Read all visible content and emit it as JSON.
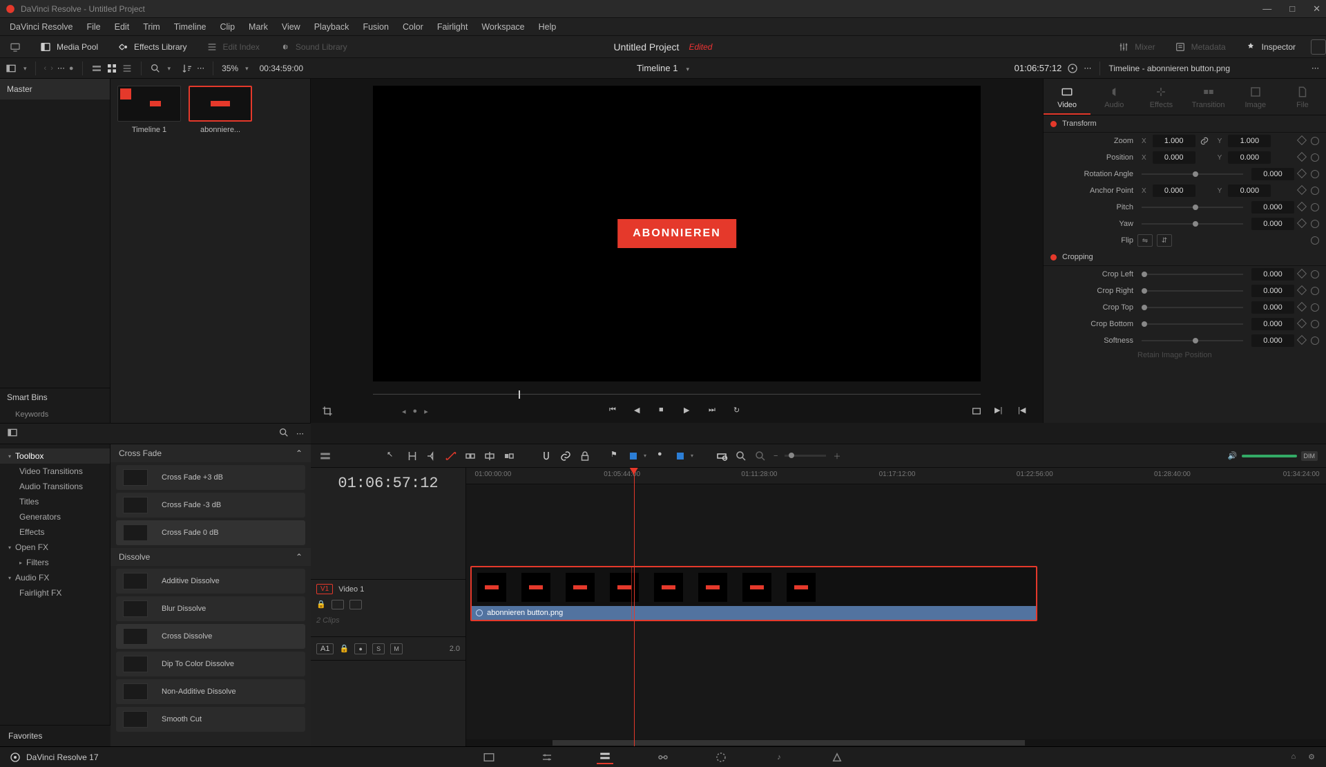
{
  "window": {
    "title": "DaVinci Resolve - Untitled Project"
  },
  "menu": [
    "DaVinci Resolve",
    "File",
    "Edit",
    "Trim",
    "Timeline",
    "Clip",
    "Mark",
    "View",
    "Playback",
    "Fusion",
    "Color",
    "Fairlight",
    "Workspace",
    "Help"
  ],
  "topPanels": {
    "mediaPool": "Media Pool",
    "effectsLib": "Effects Library",
    "editIndex": "Edit Index",
    "soundLib": "Sound Library",
    "mixer": "Mixer",
    "metadata": "Metadata",
    "inspector": "Inspector"
  },
  "project": {
    "name": "Untitled Project",
    "state": "Edited"
  },
  "subbar": {
    "zoom": "35%",
    "duration": "00:34:59:00",
    "timeline": "Timeline 1",
    "tc": "01:06:57:12"
  },
  "mediapool": {
    "root": "Master",
    "smartBins": "Smart Bins",
    "keywords": "Keywords"
  },
  "clips": [
    {
      "name": "Timeline 1",
      "selected": false,
      "timeline": true
    },
    {
      "name": "abonniere...",
      "selected": true,
      "timeline": false
    }
  ],
  "viewer": {
    "overlay": "ABONNIEREN"
  },
  "inspectorPanel": {
    "title": "Timeline - abonnieren button.png",
    "tabs": [
      "Video",
      "Audio",
      "Effects",
      "Transition",
      "Image",
      "File"
    ],
    "activeTab": 0,
    "transform": {
      "header": "Transform",
      "zoom": {
        "label": "Zoom",
        "x": "1.000",
        "y": "1.000"
      },
      "position": {
        "label": "Position",
        "x": "0.000",
        "y": "0.000"
      },
      "rotation": {
        "label": "Rotation Angle",
        "v": "0.000"
      },
      "anchor": {
        "label": "Anchor Point",
        "x": "0.000",
        "y": "0.000"
      },
      "pitch": {
        "label": "Pitch",
        "v": "0.000"
      },
      "yaw": {
        "label": "Yaw",
        "v": "0.000"
      },
      "flip": {
        "label": "Flip"
      }
    },
    "cropping": {
      "header": "Cropping",
      "left": {
        "label": "Crop Left",
        "v": "0.000"
      },
      "right": {
        "label": "Crop Right",
        "v": "0.000"
      },
      "top": {
        "label": "Crop Top",
        "v": "0.000"
      },
      "bottom": {
        "label": "Crop Bottom",
        "v": "0.000"
      },
      "soft": {
        "label": "Softness",
        "v": "0.000"
      },
      "retain": "Retain Image Position"
    }
  },
  "fxTree": {
    "toolbox": "Toolbox",
    "items": [
      "Video Transitions",
      "Audio Transitions",
      "Titles",
      "Generators",
      "Effects"
    ],
    "openfx": "Open FX",
    "filters": "Filters",
    "audiofx": "Audio FX",
    "fairlight": "Fairlight FX",
    "favorites": "Favorites"
  },
  "fxList": {
    "group1": "Cross Fade",
    "g1": [
      "Cross Fade +3 dB",
      "Cross Fade -3 dB",
      "Cross Fade 0 dB"
    ],
    "group2": "Dissolve",
    "g2": [
      "Additive Dissolve",
      "Blur Dissolve",
      "Cross Dissolve",
      "Dip To Color Dissolve",
      "Non-Additive Dissolve",
      "Smooth Cut"
    ]
  },
  "timeline": {
    "bigtc": "01:06:57:12",
    "ruler": [
      "01:00:00:00",
      "01:05:44:00",
      "01:11:28:00",
      "01:17:12:00",
      "01:22:56:00",
      "01:28:40:00",
      "01:34:24:00"
    ],
    "video": {
      "tag": "V1",
      "name": "Video 1",
      "clips": "2 Clips"
    },
    "audio": {
      "tag": "A1",
      "s": "S",
      "m": "M",
      "val": "2.0"
    },
    "clipLabel": "abonnieren button.png"
  },
  "bottom": {
    "app": "DaVinci Resolve 17"
  }
}
